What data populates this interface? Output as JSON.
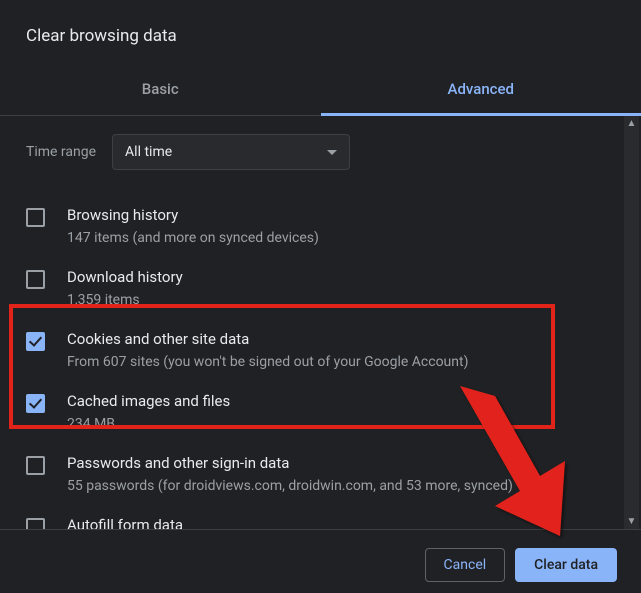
{
  "title": "Clear browsing data",
  "tabs": {
    "basic": "Basic",
    "advanced": "Advanced"
  },
  "timeRange": {
    "label": "Time range",
    "value": "All time"
  },
  "items": [
    {
      "title": "Browsing history",
      "sub": "147 items (and more on synced devices)",
      "checked": false
    },
    {
      "title": "Download history",
      "sub": "1,359 items",
      "checked": false
    },
    {
      "title": "Cookies and other site data",
      "sub": "From 607 sites (you won't be signed out of your Google Account)",
      "checked": true
    },
    {
      "title": "Cached images and files",
      "sub": "234 MB",
      "checked": true
    },
    {
      "title": "Passwords and other sign-in data",
      "sub": "55 passwords (for droidviews.com, droidwin.com, and 53 more, synced)",
      "checked": false
    },
    {
      "title": "Autofill form data",
      "sub": "",
      "checked": false
    }
  ],
  "buttons": {
    "cancel": "Cancel",
    "clear": "Clear data"
  }
}
